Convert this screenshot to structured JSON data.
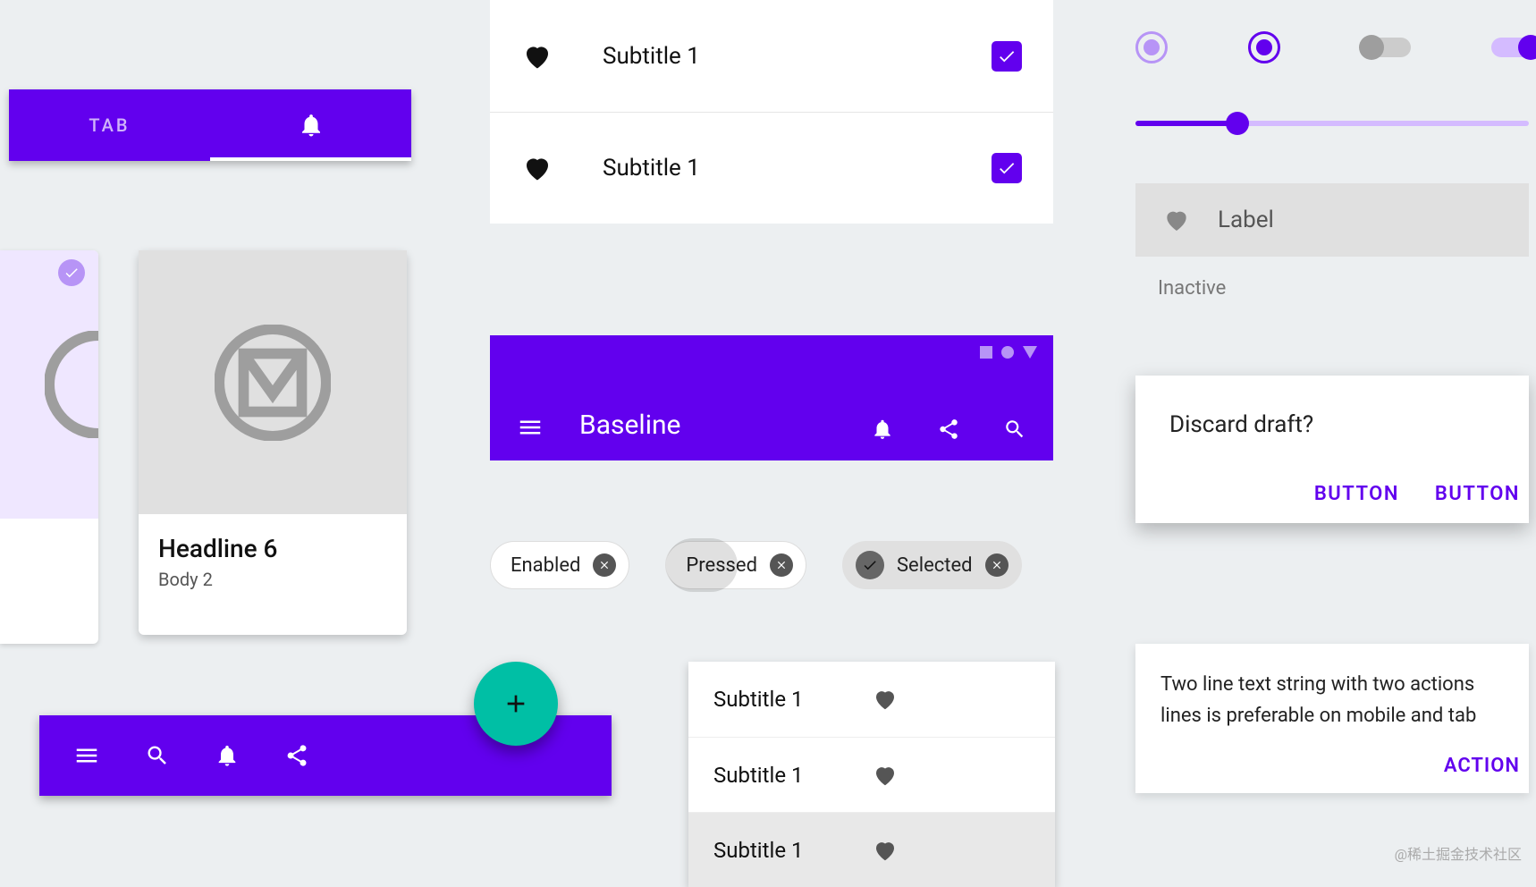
{
  "tabs": {
    "label": "TAB"
  },
  "card": {
    "headline": "Headline 6",
    "body": "Body 2"
  },
  "topList": {
    "items": [
      {
        "label": "Subtitle 1",
        "checked": true
      },
      {
        "label": "Subtitle 1",
        "checked": true
      }
    ]
  },
  "appbar": {
    "title": "Baseline"
  },
  "chips": {
    "enabled": "Enabled",
    "pressed": "Pressed",
    "selected": "Selected"
  },
  "rightList": {
    "items": [
      {
        "label": "Subtitle 1"
      },
      {
        "label": "Subtitle 1"
      },
      {
        "label": "Subtitle 1",
        "selected": true
      }
    ]
  },
  "slider": {
    "value": 26,
    "min": 0,
    "max": 100
  },
  "labelChip": {
    "text": "Label",
    "caption": "Inactive"
  },
  "dialog": {
    "message": "Discard draft?",
    "button1": "BUTTON",
    "button2": "BUTTON"
  },
  "snackbar": {
    "text": "Two line text string with two actions lines is preferable on mobile and tab",
    "action": "ACTION"
  },
  "watermark": "@稀土掘金技术社区"
}
